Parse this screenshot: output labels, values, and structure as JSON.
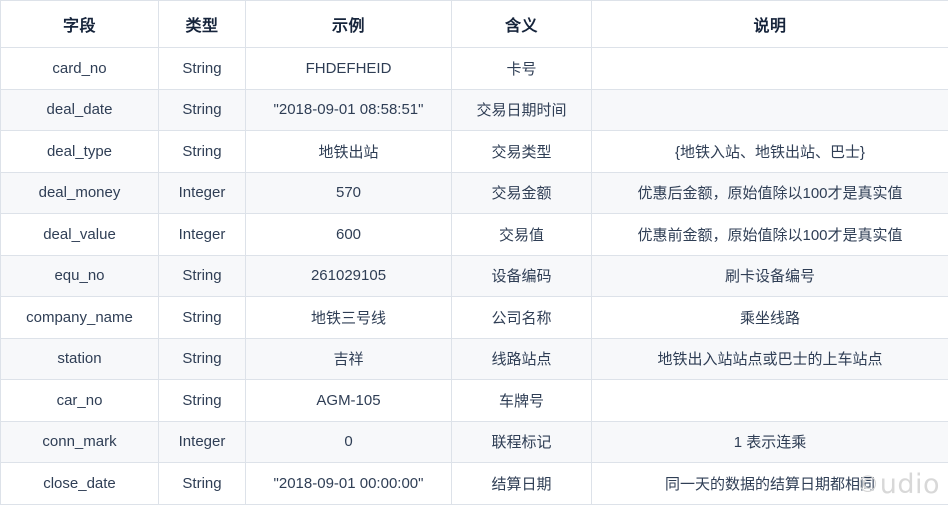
{
  "table": {
    "columns": [
      "字段",
      "类型",
      "示例",
      "含义",
      "说明"
    ],
    "rows": [
      {
        "field": "card_no",
        "type": "String",
        "example": "FHDEFHEID",
        "meaning": "卡号",
        "description": ""
      },
      {
        "field": "deal_date",
        "type": "String",
        "example": "\"2018-09-01 08:58:51\"",
        "meaning": "交易日期时间",
        "description": ""
      },
      {
        "field": "deal_type",
        "type": "String",
        "example": "地铁出站",
        "meaning": "交易类型",
        "description": "{地铁入站、地铁出站、巴士}"
      },
      {
        "field": "deal_money",
        "type": "Integer",
        "example": "570",
        "meaning": "交易金额",
        "description": "优惠后金额，原始值除以100才是真实值"
      },
      {
        "field": "deal_value",
        "type": "Integer",
        "example": "600",
        "meaning": "交易值",
        "description": "优惠前金额，原始值除以100才是真实值"
      },
      {
        "field": "equ_no",
        "type": "String",
        "example": "261029105",
        "meaning": "设备编码",
        "description": "刷卡设备编号"
      },
      {
        "field": "company_name",
        "type": "String",
        "example": "地铁三号线",
        "meaning": "公司名称",
        "description": "乘坐线路"
      },
      {
        "field": "station",
        "type": "String",
        "example": "吉祥",
        "meaning": "线路站点",
        "description": "地铁出入站站点或巴士的上车站点"
      },
      {
        "field": "car_no",
        "type": "String",
        "example": "AGM-105",
        "meaning": "车牌号",
        "description": ""
      },
      {
        "field": "conn_mark",
        "type": "Integer",
        "example": "0",
        "meaning": "联程标记",
        "description": "1 表示连乘"
      },
      {
        "field": "close_date",
        "type": "String",
        "example": "\"2018-09-01 00:00:00\"",
        "meaning": "结算日期",
        "description": "同一天的数据的结算日期都相同"
      }
    ]
  },
  "watermark": {
    "mark": "©",
    "text": "udio"
  },
  "colors": {
    "border": "#dde2e9",
    "row_stripe": "#f7f8fa",
    "text": "#2f3e55",
    "header_text": "#16243b",
    "watermark": "#d8d8d8"
  }
}
